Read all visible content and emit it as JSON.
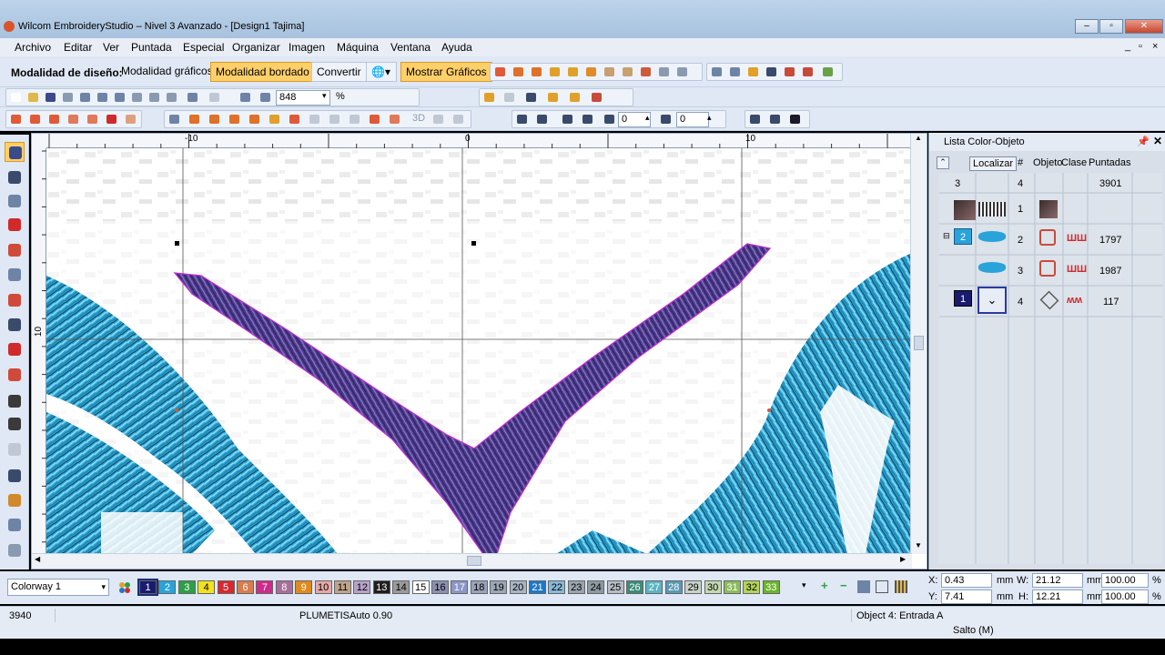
{
  "window": {
    "title": "Wilcom EmbroideryStudio – Nivel 3 Avanzado - [Design1     Tajima]",
    "controls": [
      "minimize-icon",
      "maximize-icon",
      "close-icon"
    ]
  },
  "menu": {
    "items": [
      "Archivo",
      "Editar",
      "Ver",
      "Puntada",
      "Especial",
      "Organizar",
      "Imagen",
      "Máquina",
      "Ventana",
      "Ayuda"
    ],
    "mdi_controls": [
      "_",
      "▫",
      "×"
    ]
  },
  "mode_toolbar": {
    "label": "Modalidad de diseño:",
    "graphics_mode": "Modalidad gráficos",
    "embroidery_mode": "Modalidad bordado",
    "convert": "Convertir",
    "show_graphics": "Mostrar Gráficos"
  },
  "zoom": {
    "value": "848",
    "unit": "%"
  },
  "rotation": {
    "value": "0"
  },
  "skew": {
    "value": "0"
  },
  "ruler": {
    "h_labels": [
      "-10",
      "0",
      "10"
    ],
    "v_labels": [
      "10"
    ]
  },
  "object_panel": {
    "title": "Lista Color-Objeto",
    "locate_button": "Localizar",
    "headers": {
      "num": "#",
      "object": "Objeto",
      "class": "Clase",
      "stitches": "Puntadas"
    },
    "summary": {
      "colors": "3",
      "objects": "4",
      "stitches": "3901"
    },
    "rows": [
      {
        "num": "1",
        "stitches": "",
        "color_num": ""
      },
      {
        "num": "2",
        "stitches": "1797",
        "color_num": "2"
      },
      {
        "num": "3",
        "stitches": "1987",
        "color_num": ""
      },
      {
        "num": "4",
        "stitches": "117",
        "color_num": "1"
      }
    ]
  },
  "colorway": {
    "name": "Colorway 1",
    "swatches": [
      {
        "n": "1",
        "c": "#1a1a6e"
      },
      {
        "n": "2",
        "c": "#29a3d9"
      },
      {
        "n": "3",
        "c": "#2e9e48"
      },
      {
        "n": "4",
        "c": "#f3e21b"
      },
      {
        "n": "5",
        "c": "#d9272e"
      },
      {
        "n": "6",
        "c": "#d97c50"
      },
      {
        "n": "7",
        "c": "#d02a8c"
      },
      {
        "n": "8",
        "c": "#a86f9d"
      },
      {
        "n": "9",
        "c": "#e08a1e"
      },
      {
        "n": "10",
        "c": "#e6a8a8"
      },
      {
        "n": "11",
        "c": "#bfa48a"
      },
      {
        "n": "12",
        "c": "#b7a2c8"
      },
      {
        "n": "13",
        "c": "#1e1e1e"
      },
      {
        "n": "14",
        "c": "#9a9a9a"
      },
      {
        "n": "15",
        "c": "#ffffff"
      },
      {
        "n": "16",
        "c": "#8a8fb0"
      },
      {
        "n": "17",
        "c": "#8c96c8"
      },
      {
        "n": "18",
        "c": "#9aa1b8"
      },
      {
        "n": "19",
        "c": "#9aa7b5"
      },
      {
        "n": "20",
        "c": "#a8b4c2"
      },
      {
        "n": "21",
        "c": "#1f78c8"
      },
      {
        "n": "22",
        "c": "#8ab8d8"
      },
      {
        "n": "23",
        "c": "#9aa4ad"
      },
      {
        "n": "24",
        "c": "#8e9aa0"
      },
      {
        "n": "25",
        "c": "#b4bcc4"
      },
      {
        "n": "26",
        "c": "#3c8c78"
      },
      {
        "n": "27",
        "c": "#5ab4c4"
      },
      {
        "n": "28",
        "c": "#5a9ab4"
      },
      {
        "n": "29",
        "c": "#c8d2c8"
      },
      {
        "n": "30",
        "c": "#c4d8b0"
      },
      {
        "n": "31",
        "c": "#8cbc5c"
      },
      {
        "n": "32",
        "c": "#b4d45a"
      },
      {
        "n": "33",
        "c": "#6cb42c"
      }
    ]
  },
  "coords": {
    "x": "0.43",
    "y": "7.41",
    "w": "21.12",
    "h": "12.21",
    "unit": "mm",
    "wpct": "100.00",
    "hpct": "100.00",
    "pct": "%"
  },
  "status": {
    "stitches": "3940",
    "stitch_type": "PLUMETISAuto  0.90",
    "object": "Object 4: Entrada A",
    "jump": "Salto (M)"
  },
  "colors": {
    "accent_active": "#ffcf6a",
    "thread_blue": "#29a3d9",
    "thread_purple": "#4b3a8c",
    "outline_magenta": "#c22ad8"
  }
}
